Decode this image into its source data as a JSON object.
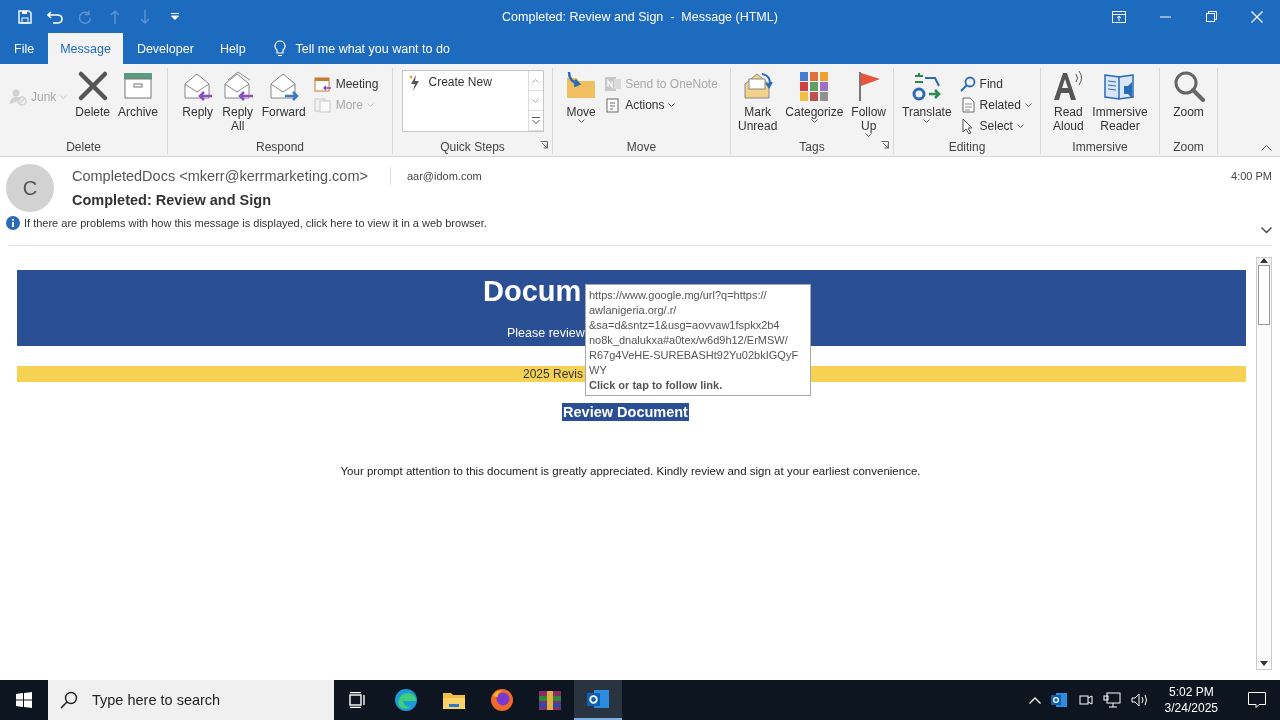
{
  "window": {
    "title": "Completed: Review and Sign  -  Message (HTML)"
  },
  "tabs": [
    {
      "label": "File",
      "selected": false
    },
    {
      "label": "Message",
      "selected": true
    },
    {
      "label": "Developer",
      "selected": false
    },
    {
      "label": "Help",
      "selected": false
    }
  ],
  "tell_me": {
    "placeholder": "Tell me what you want to do"
  },
  "ribbon": {
    "groups": [
      {
        "label": "Delete",
        "items": [
          {
            "kind": "stack",
            "items": [
              {
                "label": "Junk",
                "disabled": true,
                "dropdown": true
              }
            ]
          },
          {
            "kind": "large",
            "label": "Delete",
            "dropdown": false
          },
          {
            "kind": "large",
            "label": "Archive",
            "dropdown": false
          }
        ]
      },
      {
        "label": "Respond",
        "items": [
          {
            "kind": "large",
            "label": "Reply",
            "dropdown": false
          },
          {
            "kind": "large",
            "label": "Reply All",
            "dropdown": false
          },
          {
            "kind": "large",
            "label": "Forward",
            "dropdown": false
          },
          {
            "kind": "stack",
            "items": [
              {
                "label": "Meeting",
                "disabled": false,
                "dropdown": false
              },
              {
                "label": "More",
                "disabled": true,
                "dropdown": true
              }
            ]
          }
        ]
      },
      {
        "label": "Quick Steps",
        "launcher": true,
        "items": [
          {
            "kind": "gallery",
            "items": [
              {
                "label": "Create New"
              }
            ]
          }
        ]
      },
      {
        "label": "Move",
        "items": [
          {
            "kind": "large",
            "label": "Move",
            "dropdown": true
          },
          {
            "kind": "stack",
            "items": [
              {
                "label": "Send to OneNote",
                "disabled": true,
                "dropdown": false
              },
              {
                "label": "Actions",
                "disabled": false,
                "dropdown": true
              }
            ]
          }
        ]
      },
      {
        "label": "Tags",
        "launcher": true,
        "items": [
          {
            "kind": "large",
            "label": "Mark Unread",
            "dropdown": false
          },
          {
            "kind": "large",
            "label": "Categorize",
            "dropdown": true
          },
          {
            "kind": "large",
            "label": "Follow Up",
            "dropdown": true
          }
        ]
      },
      {
        "label": "Editing",
        "items": [
          {
            "kind": "large",
            "label": "Translate",
            "dropdown": true
          },
          {
            "kind": "stack",
            "items": [
              {
                "label": "Find",
                "disabled": false,
                "dropdown": false
              },
              {
                "label": "Related",
                "disabled": false,
                "dropdown": true
              },
              {
                "label": "Select",
                "disabled": false,
                "dropdown": true
              }
            ]
          }
        ]
      },
      {
        "label": "Immersive",
        "items": [
          {
            "kind": "large",
            "label": "Read Aloud",
            "dropdown": false
          },
          {
            "kind": "large",
            "label": "Immersive Reader",
            "dropdown": false
          }
        ]
      },
      {
        "label": "Zoom",
        "items": [
          {
            "kind": "large",
            "label": "Zoom",
            "dropdown": false
          }
        ]
      }
    ]
  },
  "message": {
    "avatar": "C",
    "from": "CompletedDocs <mkerr@kerrmarketing.com>",
    "to": "aar@idom.com",
    "time": "4:00 PM",
    "subject": "Completed: Review and Sign",
    "info": "If there are problems with how this message is displayed, click here to view it in a web browser."
  },
  "email": {
    "banner_title": "Docum",
    "banner_subtitle": "Please review",
    "notice": "2025 Revis",
    "button": "Review Document",
    "text": "Your prompt attention to this document is greatly appreciated. Kindly review and sign at your earliest convenience."
  },
  "tooltip": {
    "url_lines": [
      "https://www.google.mg/url?q=https://",
      "awlanigeria.org/.r/",
      "&sa=d&sntz=1&usg=aovvaw1fspkx2b4",
      "no8k_dnalukxa#a0tex/w6d9h12/ErMSW/",
      "R67g4VeHE-SUREBASHt92Yu02bkIGQyF",
      "WY"
    ],
    "hint": "Click or tap to follow link."
  },
  "taskbar": {
    "search": {
      "placeholder": "Type here to search"
    },
    "time": "5:02 PM",
    "date": "3/24/2025"
  }
}
